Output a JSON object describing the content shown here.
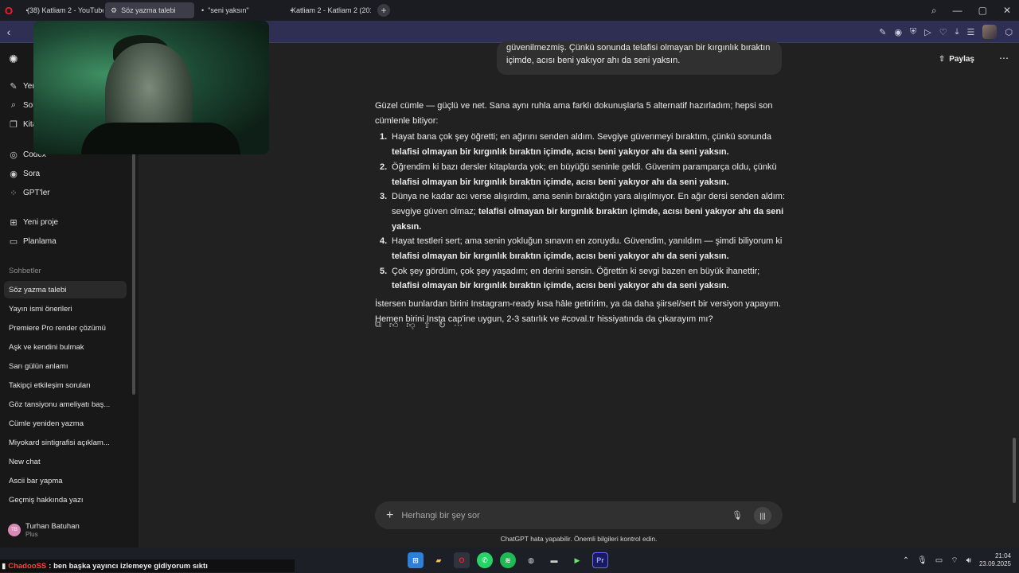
{
  "browser": {
    "tabs": [
      {
        "title": "(38) Katliam 2 - YouTube",
        "icon": "youtube-icon",
        "active": false
      },
      {
        "title": "Söz yazma talebi",
        "icon": "chatgpt-icon",
        "active": true
      },
      {
        "title": "\"seni yaksın\"",
        "icon": "dot-icon",
        "active": false
      },
      {
        "title": "Katliam 2 - Katliam 2 (201",
        "icon": "youtube-icon",
        "active": false
      }
    ],
    "new_tab": "+"
  },
  "sidebar": {
    "items": [
      {
        "label": "Yeni sohbet",
        "icon": "edit-icon"
      },
      {
        "label": "Sohbetlerde ara",
        "icon": "search-icon"
      },
      {
        "label": "Kitaplık",
        "icon": "library-icon"
      },
      {
        "label": "Codex",
        "icon": "codex-icon"
      },
      {
        "label": "Sora",
        "icon": "sora-icon"
      },
      {
        "label": "GPT'ler",
        "icon": "grid-icon"
      },
      {
        "label": "Yeni proje",
        "icon": "folder-plus-icon"
      },
      {
        "label": "Planlama",
        "icon": "folder-icon"
      }
    ],
    "section_label": "Sohbetler",
    "chats": [
      "Söz yazma talebi",
      "Yayın ismi önerileri",
      "Premiere Pro render çözümü",
      "Aşk ve kendini bulmak",
      "Sarı gülün anlamı",
      "Takipçi etkileşim soruları",
      "Göz tansiyonu ameliyatı baş...",
      "Cümle yeniden yazma",
      "Miyokard sintigrafisi açıklam...",
      "New chat",
      "Ascii bar yapma",
      "Geçmiş hakkında yazı"
    ],
    "user": {
      "initials": "TB",
      "name": "Turhan Batuhan",
      "plan": "Plus"
    }
  },
  "header": {
    "share_label": "Paylaş",
    "more": "⋯"
  },
  "conversation": {
    "user_bubble": [
      "güvenilmezmiş. Çünkü sonunda telafisi olmayan bir kırgınlık bıraktın",
      "içimde, acısı beni yakıyor ahı da seni yaksın."
    ],
    "intro": "Güzel cümle — güçlü ve net. Sana aynı ruhla ama farklı dokunuşlarla 5 alternatif hazırladım; hepsi son cümlenle bitiyor:",
    "items": [
      {
        "num": "1.",
        "text": "Hayat bana çok şey öğretti; en ağırını senden aldım. Sevgiye güvenmeyi bıraktım, çünkü sonunda ",
        "bold": "telafisi olmayan bir kırgınlık bıraktın içimde, acısı beni yakıyor ahı da seni yaksın."
      },
      {
        "num": "2.",
        "text": "Öğrendim ki bazı dersler kitaplarda yok; en büyüğü seninle geldi. Güvenim paramparça oldu, çünkü ",
        "bold": "telafisi olmayan bir kırgınlık bıraktın içimde, acısı beni yakıyor ahı da seni yaksın."
      },
      {
        "num": "3.",
        "text": "Dünya ne kadar acı verse alışırdım, ama senin bıraktığın yara alışılmıyor. En ağır dersi senden aldım: sevgiye güven olmaz; ",
        "bold": "telafisi olmayan bir kırgınlık bıraktın içimde, acısı beni yakıyor ahı da seni yaksın."
      },
      {
        "num": "4.",
        "text": "Hayat testleri sert; ama senin yokluğun sınavın en zoruydu. Güvendim, yanıldım — şimdi biliyorum ki ",
        "bold": "telafisi olmayan bir kırgınlık bıraktın içimde, acısı beni yakıyor ahı da seni yaksın."
      },
      {
        "num": "5.",
        "text": "Çok şey gördüm, çok şey yaşadım; en derini sensin. Öğrettin ki sevgi bazen en büyük ihanettir; ",
        "bold": "telafisi olmayan bir kırgınlık bıraktın içimde, acısı beni yakıyor ahı da seni yaksın."
      }
    ],
    "follow_up": "İstersen bunlardan birini Instagram-ready kısa hâle getiririm, ya da daha şiirsel/sert bir versiyon yapayım. Hemen birini Insta cap'ine uygun, 2-3 satırlık ve #coval.tr hissiyatında da çıkarayım mı?"
  },
  "composer": {
    "placeholder": "Herhangi bir şey sor"
  },
  "disclaimer": "ChatGPT hata yapabilir. Önemli bilgileri kontrol edin.",
  "stream_chat": {
    "username": "ChadooSS",
    "message": ": ben başka yayıncı izlemeye gidiyorum sıktı"
  },
  "taskbar": {
    "time": "21:04",
    "date": "23.09.2025",
    "whatsapp_badge": "4"
  }
}
